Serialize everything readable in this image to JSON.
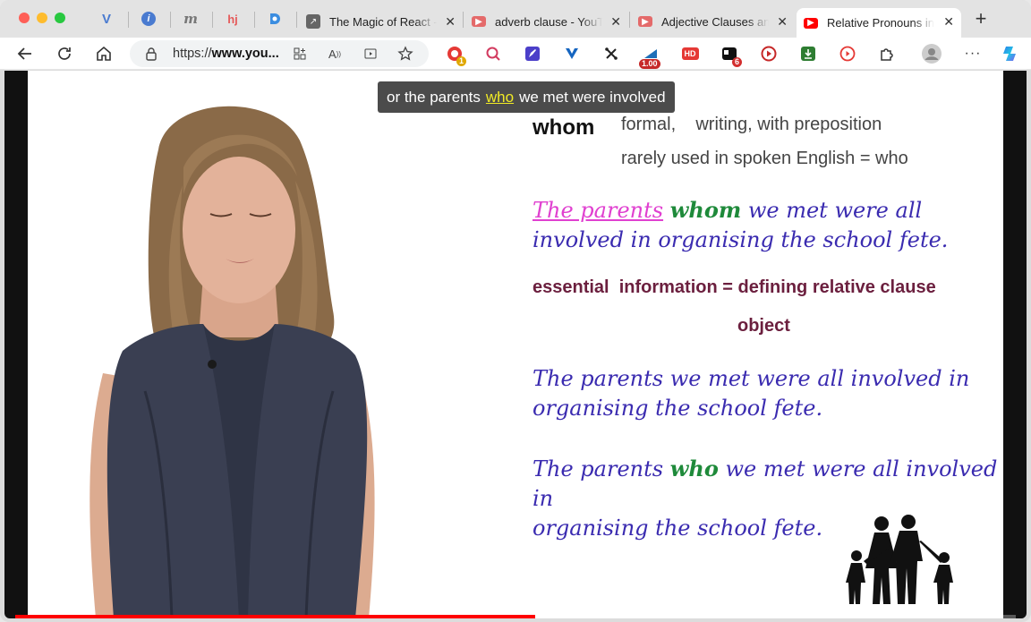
{
  "browser": {
    "pinned_tabs": [
      {
        "icon": "vivaldi-v-icon",
        "glyph": "V",
        "color": "#4a7bd0"
      },
      {
        "icon": "info-icon",
        "glyph": "i",
        "color": "#4a7bd0"
      },
      {
        "icon": "m-logo-icon",
        "glyph": "m",
        "color": "#777777"
      },
      {
        "icon": "hj-logo-icon",
        "glyph": "hj",
        "color": "#e55a5a"
      },
      {
        "icon": "d-logo-icon",
        "glyph": "D",
        "color": "#3b8de0"
      }
    ],
    "tabs": [
      {
        "title": "The Magic of React -",
        "icon": "arrow-link-icon"
      },
      {
        "title": "adverb clause - YouTube",
        "icon": "youtube-icon"
      },
      {
        "title": "Adjective Clauses and",
        "icon": "youtube-icon"
      },
      {
        "title": "Relative Pronouns in",
        "icon": "youtube-icon",
        "active": true
      }
    ],
    "url_prefix": "https://",
    "url_host": "www.you...",
    "extension_badges": {
      "first": "1",
      "speed": "1.00",
      "red": "6"
    },
    "colors": {
      "youtube_red": "#ff0000",
      "accent": "#1a73e8"
    }
  },
  "video": {
    "caption_before": "or the parents",
    "caption_highlight": "who",
    "caption_after": "we met were involved",
    "progress": 0.52,
    "slide": {
      "whom": "whom",
      "note1": "formal,    writing, with preposition",
      "note2": "rarely used in spoken English = who",
      "ex1_part1": "The parents",
      "ex1_part2": "whom",
      "ex1_part3": " we met were all",
      "ex1_line2": "involved in organising the school fete.",
      "essential": "essential  information = defining relative clause",
      "object": "object",
      "ex2_line1": "The parents we met were all involved in",
      "ex2_line2": "organising the school fete.",
      "ex3_part1": "The parents ",
      "ex3_part2": "who",
      "ex3_part3": " we met were all involved in",
      "ex3_line2": "organising the school fete."
    }
  }
}
